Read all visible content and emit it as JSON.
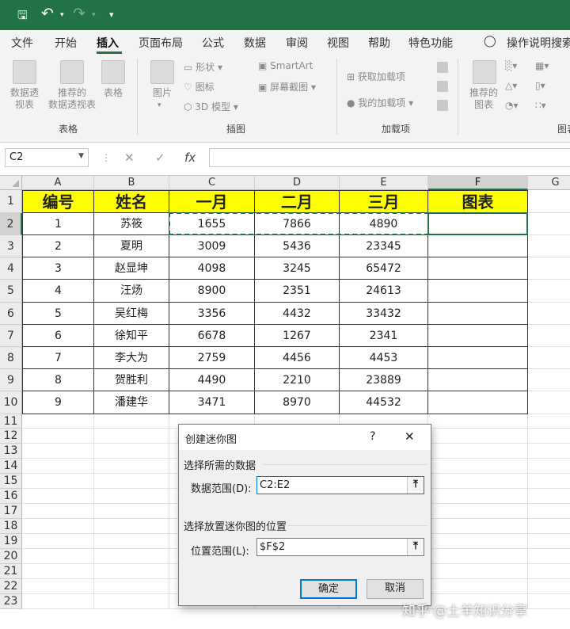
{
  "qat": {
    "icons": [
      "save-icon",
      "undo-icon",
      "redo-icon",
      "customize-icon"
    ]
  },
  "tabs": [
    "文件",
    "开始",
    "插入",
    "页面布局",
    "公式",
    "数据",
    "审阅",
    "视图",
    "帮助",
    "特色功能"
  ],
  "active_tab": "插入",
  "tell_me": "操作说明搜索",
  "ribbon": {
    "pivot_table": "数据透\n视表",
    "recommended_pivot": "推荐的\n数据透视表",
    "table": "表格",
    "group_tables": "表格",
    "picture": "图片",
    "shapes": "形状",
    "icons": "图标",
    "model3d": "3D 模型",
    "smartart": "SmartArt",
    "screenshot": "屏幕截图",
    "group_illustrations": "插图",
    "get_addins": "获取加载项",
    "my_addins": "我的加载项",
    "group_addins": "加载项",
    "recommended_charts": "推荐的\n图表",
    "group_charts": "图表"
  },
  "formula_bar": {
    "name_box": "C2",
    "cancel": "✕",
    "enter": "✓",
    "fx": "fx",
    "content": ""
  },
  "columns": [
    "A",
    "B",
    "C",
    "D",
    "E",
    "F",
    "G"
  ],
  "rows": [
    "1",
    "2",
    "3",
    "4",
    "5",
    "6",
    "7",
    "8",
    "9",
    "10",
    "11",
    "12",
    "13",
    "14",
    "15",
    "16",
    "17",
    "18",
    "19",
    "20",
    "21",
    "22",
    "23"
  ],
  "table": {
    "headers": [
      "编号",
      "姓名",
      "一月",
      "二月",
      "三月",
      "图表"
    ],
    "rows": [
      [
        "1",
        "苏筱",
        "1655",
        "7866",
        "4890",
        ""
      ],
      [
        "2",
        "夏明",
        "3009",
        "5436",
        "23345",
        ""
      ],
      [
        "3",
        "赵显坤",
        "4098",
        "3245",
        "65472",
        ""
      ],
      [
        "4",
        "汪炀",
        "8900",
        "2351",
        "24613",
        ""
      ],
      [
        "5",
        "吴红梅",
        "3356",
        "4432",
        "33432",
        ""
      ],
      [
        "6",
        "徐知平",
        "6678",
        "1267",
        "2341",
        ""
      ],
      [
        "7",
        "李大为",
        "2759",
        "4456",
        "4453",
        ""
      ],
      [
        "8",
        "贺胜利",
        "4490",
        "2210",
        "23889",
        ""
      ],
      [
        "9",
        "潘建华",
        "3471",
        "8970",
        "44532",
        ""
      ]
    ]
  },
  "dialog": {
    "title": "创建迷你图",
    "help": "?",
    "close": "✕",
    "section_data": "选择所需的数据",
    "data_range_label": "数据范围(D):",
    "data_range_value": "C2:E2",
    "section_location": "选择放置迷你图的位置",
    "location_label": "位置范围(L):",
    "location_value": "$F$2",
    "ok": "确定",
    "cancel": "取消"
  },
  "watermark": "知乎 @土羊知识分享",
  "colors": {
    "accent": "#217346",
    "header_fill": "#ffff00",
    "focus": "#0078d7"
  }
}
